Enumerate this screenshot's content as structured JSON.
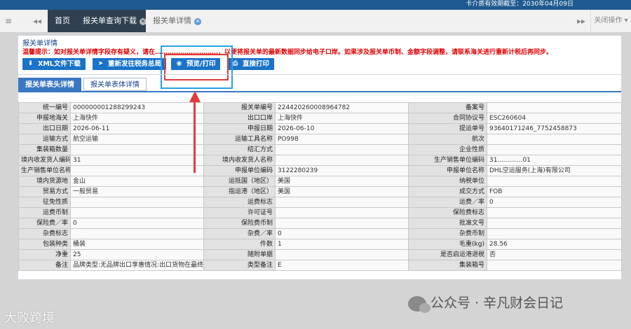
{
  "topbar": {
    "notice": "卡介质有效期截至：2030年04月09日"
  },
  "tabs": [
    {
      "label": "首页"
    },
    {
      "label": "报关单查询下载"
    },
    {
      "label": "报关单详情"
    }
  ],
  "tab_close_ops": "关闭操作",
  "panel": {
    "title": "报关单详情",
    "tip": "温馨提示：如对报关单详情字段存有疑义，请在…………………………，以便将报关单的最新数据同步给电子口岸。如果涉及报关单币制、金额字段调整，请联系海关进行重新计税后再同步。",
    "buttons": [
      {
        "label": "XML文件下载",
        "icon": "download-icon"
      },
      {
        "label": "重新发往税务总局",
        "icon": "send-icon"
      },
      {
        "label": "预览/打印",
        "icon": "eye-icon"
      },
      {
        "label": "直接打印",
        "icon": "printer-icon"
      }
    ],
    "subtabs": [
      "报关单表头详情",
      "报关单表体详情"
    ]
  },
  "grid": [
    [
      "统一编号",
      "000000001288299243",
      "报关单编号",
      "224420260008964782",
      "备案号",
      ""
    ],
    [
      "申报地海关",
      "上海快件",
      "出口口岸",
      "上海快件",
      "合同协议号",
      "ESC260604"
    ],
    [
      "出口日期",
      "2026-06-11",
      "申报日期",
      "2026-06-10",
      "提运单号",
      "93640171246_7752458873"
    ],
    [
      "运输方式",
      "航空运输",
      "运输工具名称",
      "PO998",
      "航次",
      ""
    ],
    [
      "集装箱数量",
      "",
      "结汇方式",
      "",
      "企业性质",
      ""
    ],
    [
      "境内收发货人编码",
      "31",
      "境内收发货人名称",
      "",
      "生产销售单位编码",
      "31…………01"
    ],
    [
      "生产销售单位名称",
      "",
      "申报单位编码",
      "3122280239",
      "申报单位名称",
      "DHL空运服务(上海)有限公司"
    ],
    [
      "境内货源地",
      "金山",
      "运抵国（地区）",
      "美国",
      "纳税单位",
      ""
    ],
    [
      "贸易方式",
      "一般贸易",
      "指运港（地区）",
      "美国",
      "成交方式",
      "FOB"
    ],
    [
      "征免性质",
      "",
      "运费标志",
      "",
      "运费／率",
      "0"
    ],
    [
      "运费币制",
      "",
      "许可证号",
      "",
      "保险费标志",
      ""
    ],
    [
      "保险费／率",
      "0",
      "保险费币制",
      "",
      "批准文号",
      ""
    ],
    [
      "杂费标志",
      "",
      "杂费／率",
      "0",
      "杂费币制",
      ""
    ],
    [
      "包装种类",
      "桶装",
      "件数",
      "1",
      "毛重(kg)",
      "28.56"
    ],
    [
      "净重",
      "25",
      "随附单据",
      "",
      "是否启运港退税",
      "否"
    ],
    [
      "备注",
      "品牌类型:无品牌出口享惠情况:出口货物在最终目",
      "类型备注",
      "E",
      "集装箱号",
      ""
    ]
  ],
  "watermarks": {
    "left": "大败跨境",
    "right": "公众号 · 辛凡财会日记"
  },
  "colors": {
    "accent": "#1a73c9",
    "warning": "#e00000",
    "highlight_red": "#e23b3b",
    "highlight_blue": "#2aa1e0"
  }
}
